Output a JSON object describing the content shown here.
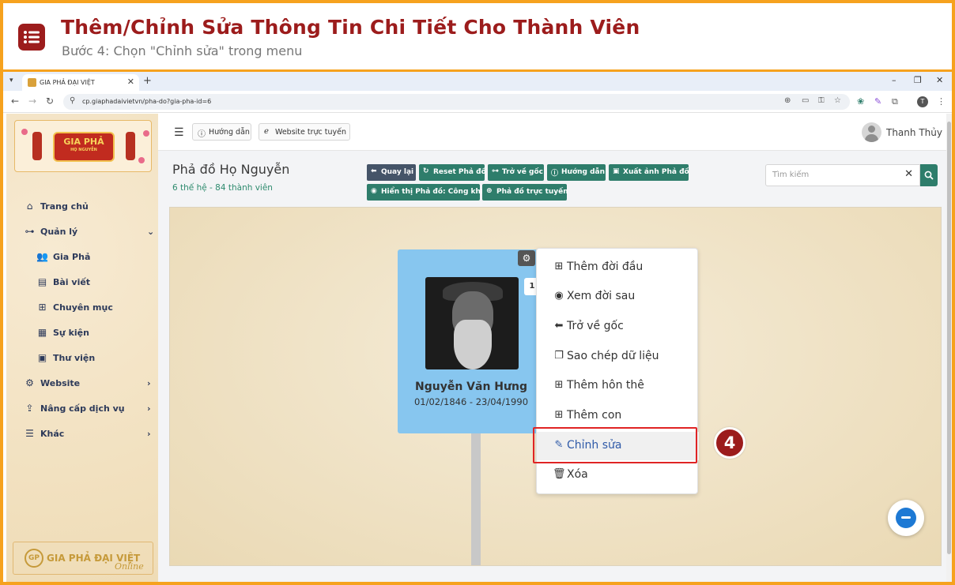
{
  "tutorial": {
    "title": "Thêm/Chỉnh Sửa Thông Tin Chi Tiết Cho Thành Viên",
    "subtitle": "Bước 4: Chọn \"Chỉnh sửa\" trong menu",
    "step_number": "4"
  },
  "browser": {
    "tab_title": "GIA PHẢ ĐẠI VIỆT",
    "url": "cp.giaphadaivietvn/pha-do?gia-pha-id=6",
    "profile_initial": "T",
    "accent": "#f6a21e"
  },
  "sidebar": {
    "logo_text": "GIA PHẢ",
    "logo_sub": "HỌ NGUYỄN",
    "items": [
      {
        "label": "Trang chủ",
        "icon": "home-icon"
      },
      {
        "label": "Quản lý",
        "icon": "sitemap-icon"
      },
      {
        "label": "Gia Phả",
        "icon": "users-icon"
      },
      {
        "label": "Bài viết",
        "icon": "newspaper-icon"
      },
      {
        "label": "Chuyên mục",
        "icon": "grid-icon"
      },
      {
        "label": "Sự kiện",
        "icon": "calendar-icon"
      },
      {
        "label": "Thư viện",
        "icon": "images-icon"
      },
      {
        "label": "Website",
        "icon": "gear-icon"
      },
      {
        "label": "Nâng cấp dịch vụ",
        "icon": "upgrade-icon"
      },
      {
        "label": "Khác",
        "icon": "menu-icon"
      }
    ],
    "footer_badge": "GP",
    "footer_text": "GIA PHẢ ĐẠI VIỆT",
    "footer_online": "Online"
  },
  "topnav": {
    "help_label": "Hướng dẫn",
    "website_label": "Website trực tuyến",
    "username": "Thanh Thủy"
  },
  "page": {
    "title": "Phả đồ Họ Nguyễn",
    "stats": "6 thế hệ - 84 thành viên",
    "toolbar": {
      "back": "Quay lại",
      "reset": "Reset Phả đồ",
      "root": "Trở về gốc",
      "help": "Hướng dẫn",
      "export": "Xuất ảnh Phả đồ",
      "visibility": "Hiển thị Phả đồ: Công khai",
      "online": "Phả đồ trực tuyến"
    },
    "search_placeholder": "Tìm kiếm"
  },
  "person": {
    "name": "Nguyễn Văn Hưng",
    "dates": "01/02/1846 - 23/04/1990",
    "generation_badge": "1"
  },
  "context_menu": {
    "items": [
      {
        "label": "Thêm đời đầu",
        "icon": "plus-square-icon"
      },
      {
        "label": "Xem đời sau",
        "icon": "eye-icon"
      },
      {
        "label": "Trở về gốc",
        "icon": "arrow-left-icon"
      },
      {
        "label": "Sao chép dữ liệu",
        "icon": "copy-icon"
      },
      {
        "label": "Thêm hôn thê",
        "icon": "plus-square-icon"
      },
      {
        "label": "Thêm con",
        "icon": "plus-square-icon"
      },
      {
        "label": "Chỉnh sửa",
        "icon": "edit-icon",
        "highlighted": true
      },
      {
        "label": "Xóa",
        "icon": "trash-icon"
      }
    ]
  },
  "colors": {
    "brand_red": "#9c1c1c",
    "teal": "#2e7d6b",
    "card_blue": "#87c6ef",
    "highlight": "#e02424"
  }
}
